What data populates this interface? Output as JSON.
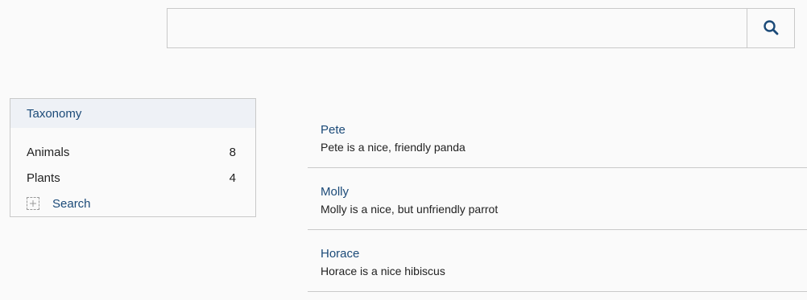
{
  "search": {
    "value": "",
    "placeholder": "",
    "icon": "search-icon"
  },
  "facet": {
    "title": "Taxonomy",
    "items": [
      {
        "label": "Animals",
        "count": "8"
      },
      {
        "label": "Plants",
        "count": "4"
      }
    ],
    "search_label": "Search",
    "search_icon": "plus-icon"
  },
  "results": [
    {
      "title": "Pete",
      "description": "Pete is a nice, friendly panda"
    },
    {
      "title": "Molly",
      "description": "Molly is a nice, but unfriendly parrot"
    },
    {
      "title": "Horace",
      "description": "Horace is a nice hibiscus"
    }
  ],
  "colors": {
    "link": "#1b4a78",
    "border": "#c9c9c9",
    "header_bg": "#eef1f6"
  }
}
